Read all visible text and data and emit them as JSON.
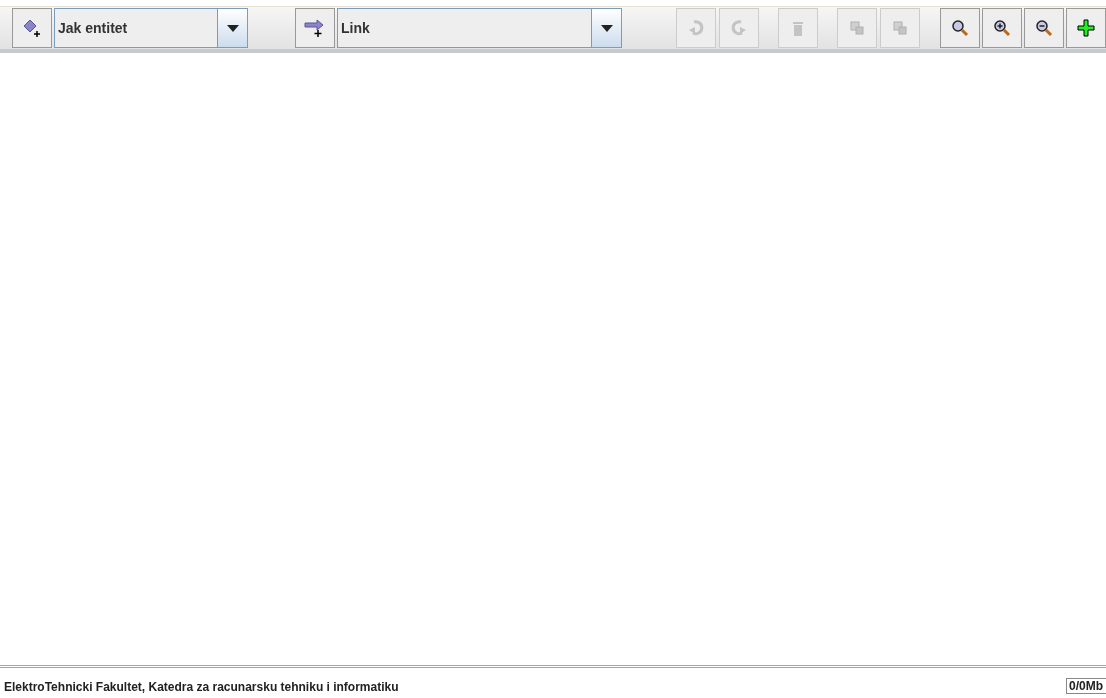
{
  "toolbar": {
    "groups": [
      {
        "kind": "creator",
        "combo": {
          "value": "Jak entitet"
        }
      },
      {
        "kind": "creator",
        "combo": {
          "value": "Link"
        }
      },
      {
        "kind": "buttons",
        "buttons": [
          {
            "disabled": true
          },
          {
            "disabled": true
          }
        ]
      },
      {
        "kind": "buttons",
        "buttons": [
          {
            "disabled": true
          }
        ]
      },
      {
        "kind": "buttons",
        "buttons": [
          {
            "disabled": true
          },
          {
            "disabled": true
          }
        ]
      },
      {
        "kind": "buttons",
        "buttons": [
          {
            "disabled": false
          },
          {
            "disabled": false
          },
          {
            "disabled": false
          },
          {
            "disabled": false
          }
        ]
      }
    ]
  },
  "status_bar": {
    "message": "ElektroTehnicki Fakultet, Katedra za racunarsku tehniku i informatiku",
    "memory": "0/0Mb"
  }
}
